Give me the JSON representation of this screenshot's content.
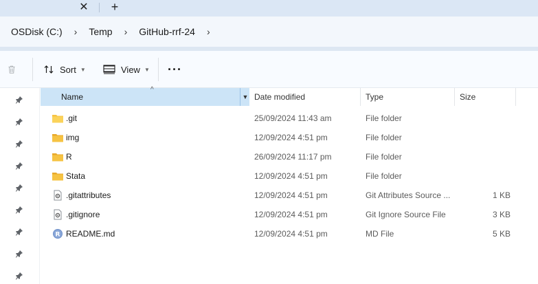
{
  "tabstrip": {
    "close_glyph": "✕",
    "new_tab_glyph": "+"
  },
  "address": {
    "crumbs": [
      "OSDisk (C:)",
      "Temp",
      "GitHub-rrf-24"
    ],
    "separator": "›"
  },
  "commandbar": {
    "sort_label": "Sort",
    "view_label": "View",
    "more_label": "···"
  },
  "columns": {
    "name": "Name",
    "date": "Date modified",
    "type": "Type",
    "size": "Size"
  },
  "files": [
    {
      "name": ".git",
      "date": "25/09/2024 11:43 am",
      "type": "File folder",
      "size": "",
      "icon": "folder-icon"
    },
    {
      "name": "img",
      "date": "12/09/2024 4:51 pm",
      "type": "File folder",
      "size": "",
      "icon": "folder-icon"
    },
    {
      "name": "R",
      "date": "26/09/2024 11:17 pm",
      "type": "File folder",
      "size": "",
      "icon": "folder-icon"
    },
    {
      "name": "Stata",
      "date": "12/09/2024 4:51 pm",
      "type": "File folder",
      "size": "",
      "icon": "folder-icon"
    },
    {
      "name": ".gitattributes",
      "date": "12/09/2024 4:51 pm",
      "type": "Git Attributes Source ...",
      "size": "1 KB",
      "icon": "settings-file-icon"
    },
    {
      "name": ".gitignore",
      "date": "12/09/2024 4:51 pm",
      "type": "Git Ignore Source File",
      "size": "3 KB",
      "icon": "settings-file-icon"
    },
    {
      "name": "README.md",
      "date": "12/09/2024 4:51 pm",
      "type": "MD File",
      "size": "5 KB",
      "icon": "r-markdown-icon"
    }
  ],
  "colors": {
    "accent_header": "#cce4f7",
    "folder": "#f6c343",
    "tabstrip": "#dbe7f5"
  }
}
